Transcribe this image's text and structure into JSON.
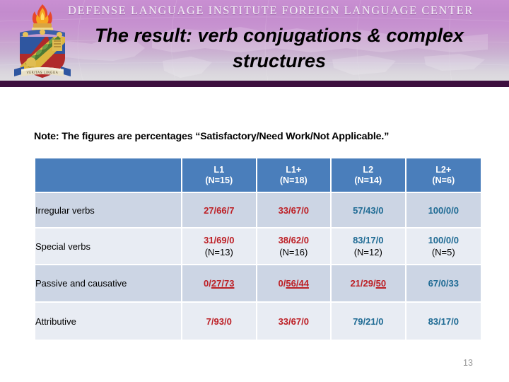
{
  "banner": {
    "institute_line": "DEFENSE LANGUAGE INSTITUTE FOREIGN LANGUAGE CENTER",
    "slide_title": "The result: verb conjugations & complex structures",
    "crest_icon": "dli-crest-icon",
    "bar_color": "#3d0f3f"
  },
  "note": "Note: The figures are percentages “Satisfactory/Need Work/Not Applicable.”",
  "table": {
    "corner_label": "",
    "columns": [
      {
        "level": "L1",
        "n": "(N=15)"
      },
      {
        "level": "L1+",
        "n": "(N=18)"
      },
      {
        "level": "L2",
        "n": "(N=14)"
      },
      {
        "level": "L2+",
        "n": "(N=6)"
      }
    ],
    "rows": [
      {
        "label": "Irregular verbs",
        "cells": [
          {
            "value": "27/66/7",
            "color": "red",
            "sub": ""
          },
          {
            "value": "33/67/0",
            "color": "red",
            "sub": ""
          },
          {
            "value": "57/43/0",
            "color": "blue",
            "sub": ""
          },
          {
            "value": "100/0/0",
            "color": "blue",
            "sub": ""
          }
        ]
      },
      {
        "label": "Special verbs",
        "cells": [
          {
            "value": "31/69/0",
            "color": "red",
            "sub": "(N=13)"
          },
          {
            "value": "38/62/0",
            "color": "red",
            "sub": "(N=16)"
          },
          {
            "value": "83/17/0",
            "color": "blue",
            "sub": "(N=12)"
          },
          {
            "value": "100/0/0",
            "color": "blue",
            "sub": "(N=5)"
          }
        ]
      },
      {
        "label": "Passive and causative",
        "cells": [
          {
            "value": "0/27/73",
            "color": "red",
            "sub": "",
            "plain": "0/",
            "underlined": "27/73"
          },
          {
            "value": "0/56/44",
            "color": "red",
            "sub": "",
            "plain": "0/",
            "underlined": "56/44"
          },
          {
            "value": "21/29/50",
            "color": "red",
            "sub": "",
            "plain": "21/29/",
            "underlined": "50"
          },
          {
            "value": "67/0/33",
            "color": "blue",
            "sub": ""
          }
        ]
      },
      {
        "label": "Attributive",
        "cells": [
          {
            "value": "7/93/0",
            "color": "red",
            "sub": ""
          },
          {
            "value": "33/67/0",
            "color": "red",
            "sub": ""
          },
          {
            "value": "79/21/0",
            "color": "blue",
            "sub": ""
          },
          {
            "value": "83/17/0",
            "color": "blue",
            "sub": ""
          }
        ]
      }
    ]
  },
  "page_number": "13",
  "colors": {
    "header_blue": "#4a7ebb",
    "row_odd": "#ccd5e4",
    "row_even": "#e8ecf3",
    "value_red": "#bd2026",
    "value_blue": "#1f6b94"
  }
}
